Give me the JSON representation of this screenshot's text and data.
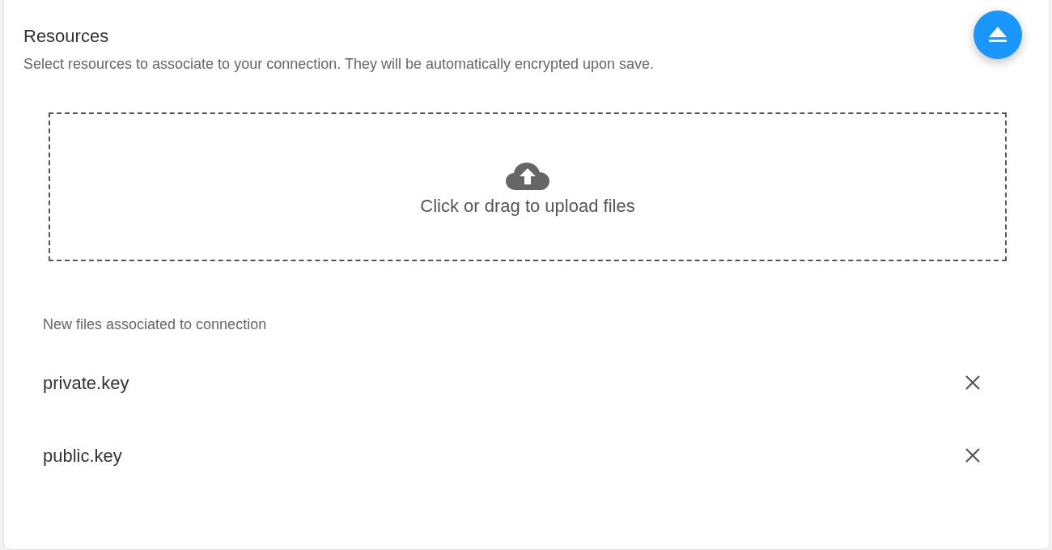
{
  "section": {
    "title": "Resources",
    "description": "Select resources to associate to your connection. They will be automatically encrypted upon save."
  },
  "dropzone": {
    "label": "Click or drag to upload files"
  },
  "files": {
    "heading": "New files associated to connection",
    "items": [
      {
        "name": "private.key"
      },
      {
        "name": "public.key"
      }
    ]
  }
}
